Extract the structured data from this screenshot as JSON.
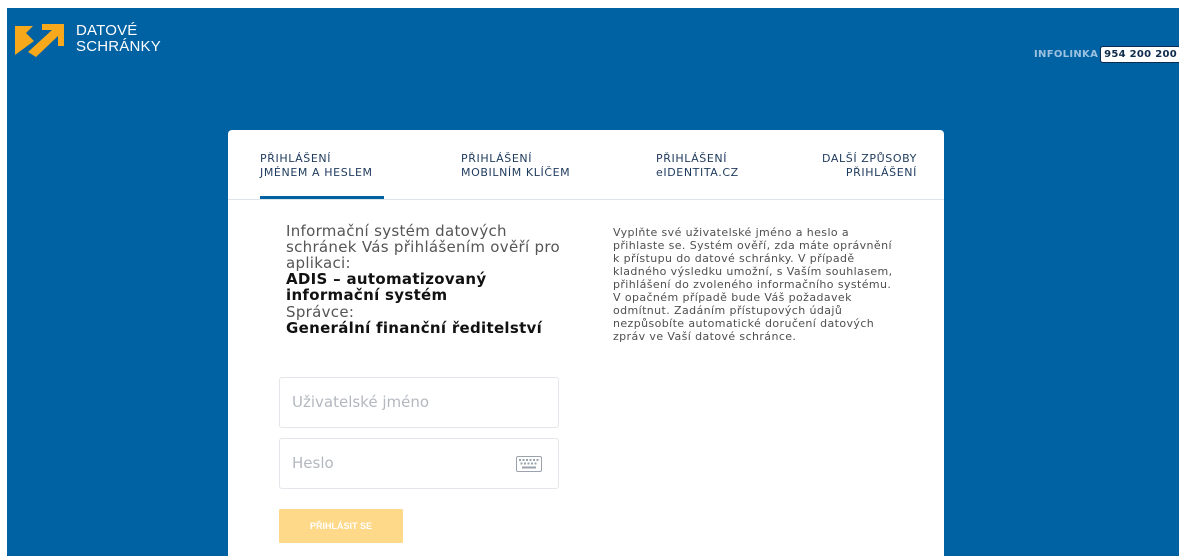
{
  "brand": {
    "line1": "DATOVÉ",
    "line2": "SCHRÁNKY",
    "accent_color": "#f7a81b",
    "background_color": "#0061a3"
  },
  "infolinka": {
    "label": "INFOLINKA",
    "phone": "954 200 200"
  },
  "tabs": [
    {
      "line1": "PŘIHLÁŠENÍ",
      "line2": "JMÉNEM A HESLEM",
      "active": true
    },
    {
      "line1": "PŘIHLÁŠENÍ",
      "line2": "MOBILNÍM KLÍČEM",
      "active": false
    },
    {
      "line1": "PŘIHLÁŠENÍ",
      "line2": "eIDENTITA.CZ",
      "active": false
    },
    {
      "line1": "DALŠÍ ZPŮSOBY",
      "line2": "PŘIHLÁŠENÍ",
      "active": false
    }
  ],
  "info": {
    "intro": "Informační systém datových schránek Vás přihlášením ověří pro aplikaci:",
    "app_name": "ADIS – automatizovaný informační systém",
    "admin_label": "Správce:",
    "admin_name": "Generální finanční ředitelství"
  },
  "form": {
    "username_placeholder": "Uživatelské jméno",
    "username_value": "",
    "password_placeholder": "Heslo",
    "password_value": "",
    "keyboard_icon": "keyboard-icon",
    "submit_label": "PŘIHLÁSIT SE"
  },
  "description": "Vyplňte své uživatelské jméno a heslo a přihlaste se. Systém ověří, zda máte oprávnění k přístupu do datové schránky. V případě kladného výsledku umožní, s Vaším souhlasem, přihlášení do zvoleného informačního systému. V opačném případě bude Váš požadavek odmítnut. Zadáním přístupových údajů nezpůsobíte automatické doručení datových zpráv ve Vaší datové schránce."
}
